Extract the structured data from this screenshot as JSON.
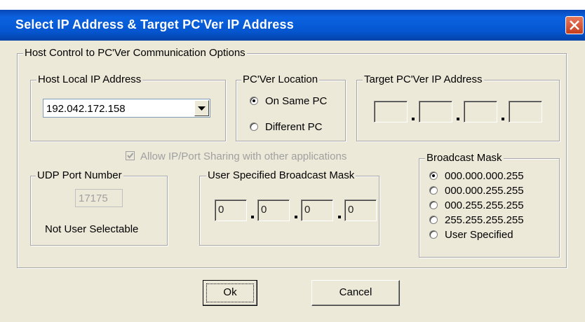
{
  "window": {
    "title": "Select IP Address & Target PC'Ver IP Address"
  },
  "host_group": {
    "label": "Host Control to PC'Ver Communication Options"
  },
  "local_ip": {
    "label": "Host Local IP Address",
    "value": "192.042.172.158"
  },
  "location": {
    "label": "PC'Ver Location",
    "options": [
      {
        "label": "On Same PC",
        "selected": true
      },
      {
        "label": "Different PC",
        "selected": false
      }
    ]
  },
  "target_ip": {
    "label": "Target PC'Ver IP Address",
    "octets": [
      "",
      "",
      "",
      ""
    ]
  },
  "sharing": {
    "label": "Allow IP/Port Sharing with other applications",
    "checked": true,
    "disabled": true
  },
  "udp": {
    "label": "UDP Port Number",
    "value": "17175",
    "note": "Not User Selectable"
  },
  "user_mask": {
    "label": "User Specified Broadcast Mask",
    "octets": [
      "0",
      "0",
      "0",
      "0"
    ]
  },
  "broadcast_mask": {
    "label": "Broadcast Mask",
    "options": [
      {
        "label": "000.000.000.255",
        "selected": true
      },
      {
        "label": "000.000.255.255",
        "selected": false
      },
      {
        "label": "000.255.255.255",
        "selected": false
      },
      {
        "label": "255.255.255.255",
        "selected": false
      },
      {
        "label": "User Specified",
        "selected": false
      }
    ]
  },
  "buttons": {
    "ok": "Ok",
    "cancel": "Cancel"
  }
}
